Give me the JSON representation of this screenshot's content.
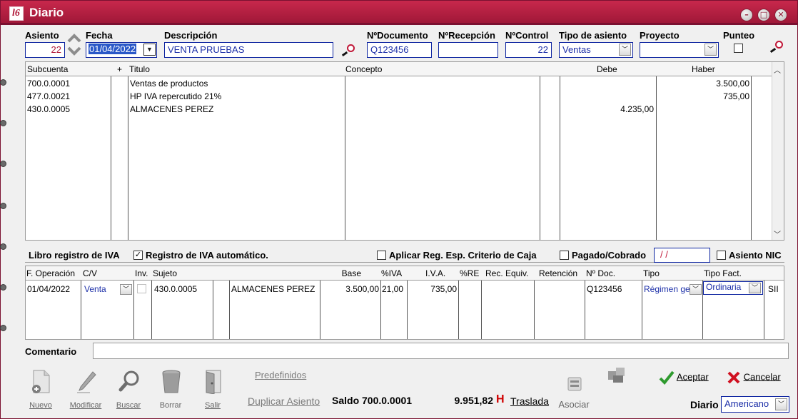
{
  "window": {
    "title": "Diario",
    "logo_text": "l6"
  },
  "header": {
    "labels": {
      "asiento": "Asiento",
      "fecha": "Fecha",
      "descripcion": "Descripción",
      "ndocumento": "NºDocumento",
      "nrecepcion": "NºRecepción",
      "ncontrol": "NºControl",
      "tipo_asiento": "Tipo de asiento",
      "proyecto": "Proyecto",
      "punteo": "Punteo"
    },
    "values": {
      "asiento": "22",
      "fecha": "01/04/2022",
      "descripcion": "VENTA PRUEBAS",
      "ndocumento": "Q123456",
      "nrecepcion": "",
      "ncontrol": "22",
      "tipo_asiento": "Ventas",
      "proyecto": ""
    }
  },
  "entries": {
    "columns": {
      "subcuenta": "Subcuenta",
      "plus": "+",
      "titulo": "Titulo",
      "concepto": "Concepto",
      "debe": "Debe",
      "haber": "Haber"
    },
    "rows": [
      {
        "subcuenta": "700.0.0001",
        "titulo": "Ventas de productos",
        "concepto": "",
        "debe": "",
        "haber": "3.500,00"
      },
      {
        "subcuenta": "477.0.0021",
        "titulo": "HP IVA repercutido 21%",
        "concepto": "",
        "debe": "",
        "haber": "735,00"
      },
      {
        "subcuenta": "430.0.0005",
        "titulo": "ALMACENES PEREZ",
        "concepto": "",
        "debe": "4.235,00",
        "haber": ""
      }
    ]
  },
  "iva": {
    "title": "Libro registro de IVA",
    "registro_auto": "Registro de IVA automático.",
    "aplicar_reg": "Aplicar Reg. Esp. Criterio de Caja",
    "pagado": "Pagado/Cobrado",
    "pagado_date": " / /",
    "asiento_nic": "Asiento NIC",
    "columns": {
      "f_operacion": "F. Operación",
      "cv": "C/V",
      "inv": "Inv.",
      "sujeto": "Sujeto",
      "base": "Base",
      "piva": "%IVA",
      "iva": "I.V.A.",
      "pre": "%RE",
      "rec_equiv": "Rec. Equiv.",
      "retencion": "Retención",
      "ndoc": "Nº Doc.",
      "tipo": "Tipo",
      "tipo_fact": "Tipo Fact."
    },
    "row": {
      "f_operacion": "01/04/2022",
      "cv": "Venta",
      "sujeto": "430.0.0005",
      "nombre": "ALMACENES PEREZ",
      "base": "3.500,00",
      "piva": "21,00",
      "iva": "735,00",
      "ndoc": "Q123456",
      "tipo": "Régimen ge",
      "tipo_fact": "Ordinaria",
      "sii": "SII"
    }
  },
  "comentario": {
    "label": "Comentario",
    "value": ""
  },
  "toolbar": {
    "nuevo": "Nuevo",
    "modificar": "Modificar",
    "buscar": "Buscar",
    "borrar": "Borrar",
    "salir": "Salir",
    "predefinidos": "Predefinidos",
    "duplicar": "Duplicar Asiento",
    "saldo_label": "Saldo 700.0.0001",
    "saldo_value": "9.951,82",
    "saldo_side": "H",
    "traslada": "Traslada",
    "asociar": "Asociar",
    "aceptar": "Aceptar",
    "cancelar": "Cancelar",
    "diario_label": "Diario",
    "diario_value": "Americano"
  },
  "colors": {
    "titlebar": "#b01f42",
    "field_text": "#1c2fa8",
    "saldo_h": "#d00000",
    "aceptar_icon": "#2e9a2e",
    "cancelar_icon": "#d01020"
  },
  "icons": [
    "close-icon",
    "maximize-icon",
    "minimize-icon",
    "search-icon",
    "chevron-down-icon",
    "chevron-up-icon",
    "new-document-icon",
    "pencil-icon",
    "magnifier-icon",
    "trash-icon",
    "door-exit-icon",
    "checkmark-icon",
    "cross-icon",
    "link-icon",
    "shuffle-icon"
  ]
}
